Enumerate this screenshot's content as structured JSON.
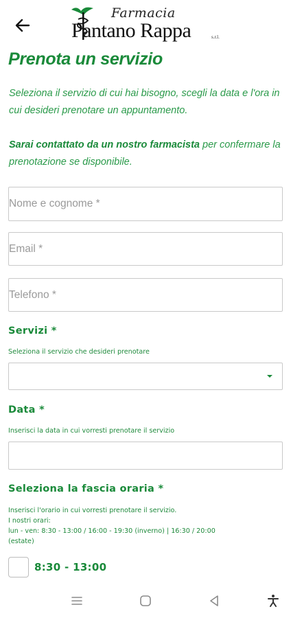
{
  "header": {
    "back_icon": "arrow-left-icon",
    "logo": {
      "script_text": "Farmacia",
      "name_text": "Pantano Rappa",
      "suffix": "s.r.l."
    }
  },
  "page": {
    "title": "Prenota un servizio",
    "intro_text": "Seleziona il servizio di cui hai bisogno, scegli la data e l'ora in cui desideri prenotare un appuntamento.",
    "contact_strong": "Sarai contattato da un nostro farmacista",
    "contact_rest": " per confermare la prenotazione se disponibile."
  },
  "form": {
    "name": {
      "placeholder": "Nome e cognome *",
      "value": ""
    },
    "email": {
      "placeholder": "Email *",
      "value": ""
    },
    "phone": {
      "placeholder": "Telefono *",
      "value": ""
    },
    "services": {
      "label": "Servizi *",
      "help": "Seleziona il servizio che desideri prenotare",
      "selected": "",
      "caret_icon": "caret-down-icon"
    },
    "date": {
      "label": "Data *",
      "help": "Inserisci la data in cui vorresti prenotare il servizio",
      "value": ""
    },
    "timeslot": {
      "label": "Seleziona la fascia oraria *",
      "help_line1": "Inserisci l'orario in cui vorresti prenotare il servizio.",
      "help_line2": "I nostri orari:",
      "help_line3": "lun - ven: 8:30 - 13:00 / 16:00 - 19:30 (inverno) | 16:30 / 20:00",
      "help_line4": "(estate)",
      "options": [
        {
          "label": "8:30 - 13:00",
          "checked": false
        }
      ]
    }
  },
  "system_nav": {
    "recents_icon": "recents-icon",
    "home_icon": "home-icon",
    "back_icon": "back-triangle-icon",
    "accessibility_icon": "accessibility-icon"
  },
  "colors": {
    "accent_green": "#1a8a3a",
    "text_green": "#2a9a4a",
    "border": "#c9c9c9"
  }
}
